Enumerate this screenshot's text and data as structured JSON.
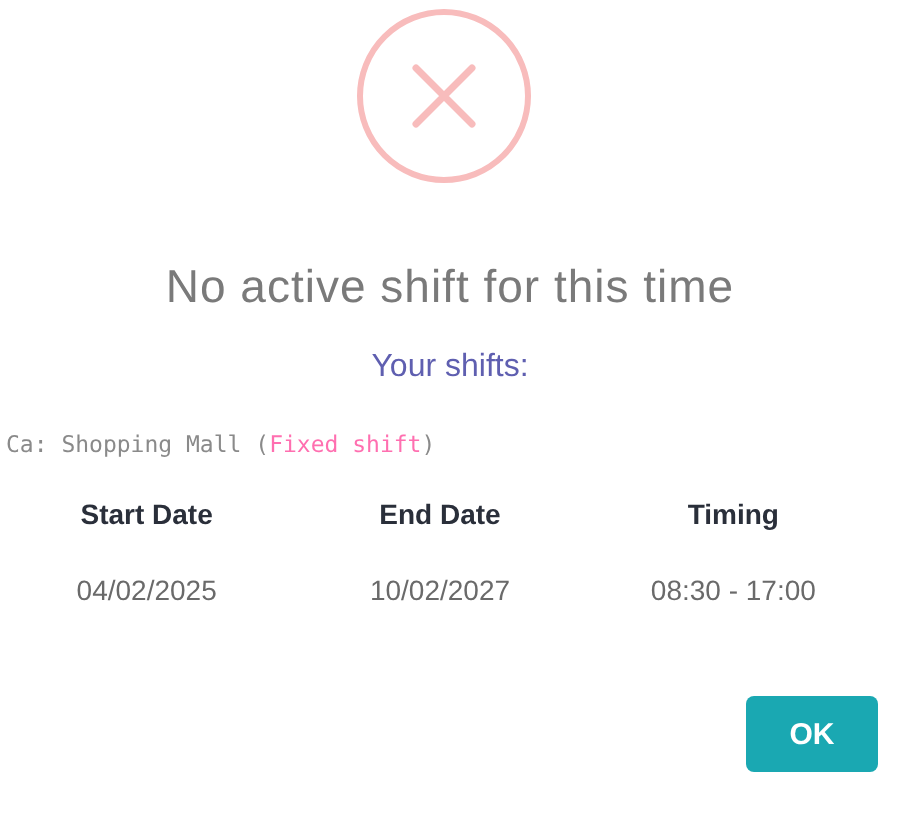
{
  "title": "No active shift for this time",
  "subtitle": "Your shifts:",
  "shift": {
    "location": "Ca: Shopping Mall",
    "open": "(",
    "type": "Fixed shift",
    "close": ")"
  },
  "table": {
    "columns": [
      "Start Date",
      "End Date",
      "Timing"
    ],
    "rows": [
      [
        "04/02/2025",
        "10/02/2027",
        "08:30 - 17:00"
      ]
    ]
  },
  "buttons": [
    {
      "label": "OK",
      "kind": "confirm"
    }
  ]
}
